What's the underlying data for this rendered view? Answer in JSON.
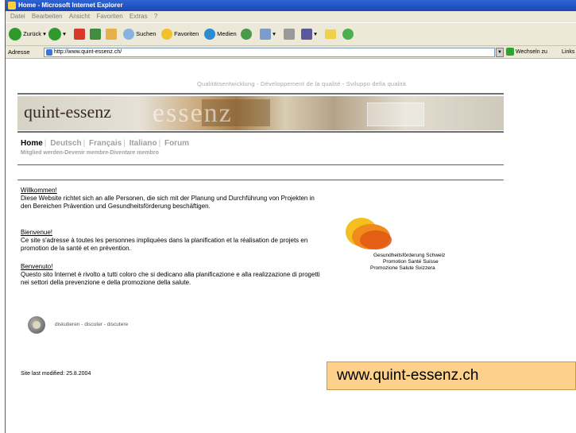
{
  "window": {
    "title": "Home - Microsoft Internet Explorer"
  },
  "menu": [
    "Datei",
    "Bearbeiten",
    "Ansicht",
    "Favoriten",
    "Extras",
    "?"
  ],
  "toolbar": {
    "back_label": "Zurück",
    "search_label": "Suchen",
    "favorites_label": "Favoriten",
    "media_label": "Medien"
  },
  "address_bar": {
    "label": "Adresse",
    "url": "http://www.quint-essenz.ch/",
    "go_label": "Wechseln zu",
    "links_label": "Links"
  },
  "page": {
    "tagline": "Qualitätsentwicklung - Développement de la qualité - Sviluppo della qualità",
    "logo_text": "quint-essenz",
    "logo_ghost_text": "essenz",
    "nav": [
      "Home",
      "Deutsch",
      "Français",
      "Italiano",
      "Forum"
    ],
    "subnav": "Mitglied werden-Devenir membre-Diventare membro",
    "welcome": [
      {
        "heading": "Willkommen!",
        "text": "Diese Website richtet sich an alle Personen, die sich mit der Planung und Durchführung von Projekten in den Bereichen Prävention und Gesundheitsförderung beschäftigen."
      },
      {
        "heading": "Bienvenue!",
        "text": "Ce site s'adresse à toutes les personnes impliquées dans la planification et la réalisation de projets en promotion de la santé et en prévention."
      },
      {
        "heading": "Benvenuto!",
        "text": "Questo sito Internet è rivolto a tutti coloro che si dedicano alla planificazione e alla realizzazione di progetti nei settori della prevenzione e della promozione della salute."
      }
    ],
    "partner": {
      "line1": "Gesundheitsförderung Schweiz",
      "line2": "Promotion Santé Suisse",
      "line3": "Promozione Salute Svizzera"
    },
    "discuss_label": "diskutieren - discuter - discutere",
    "modified": "Site last modified: 25.8.2004"
  },
  "caption": "www.quint-essenz.ch"
}
